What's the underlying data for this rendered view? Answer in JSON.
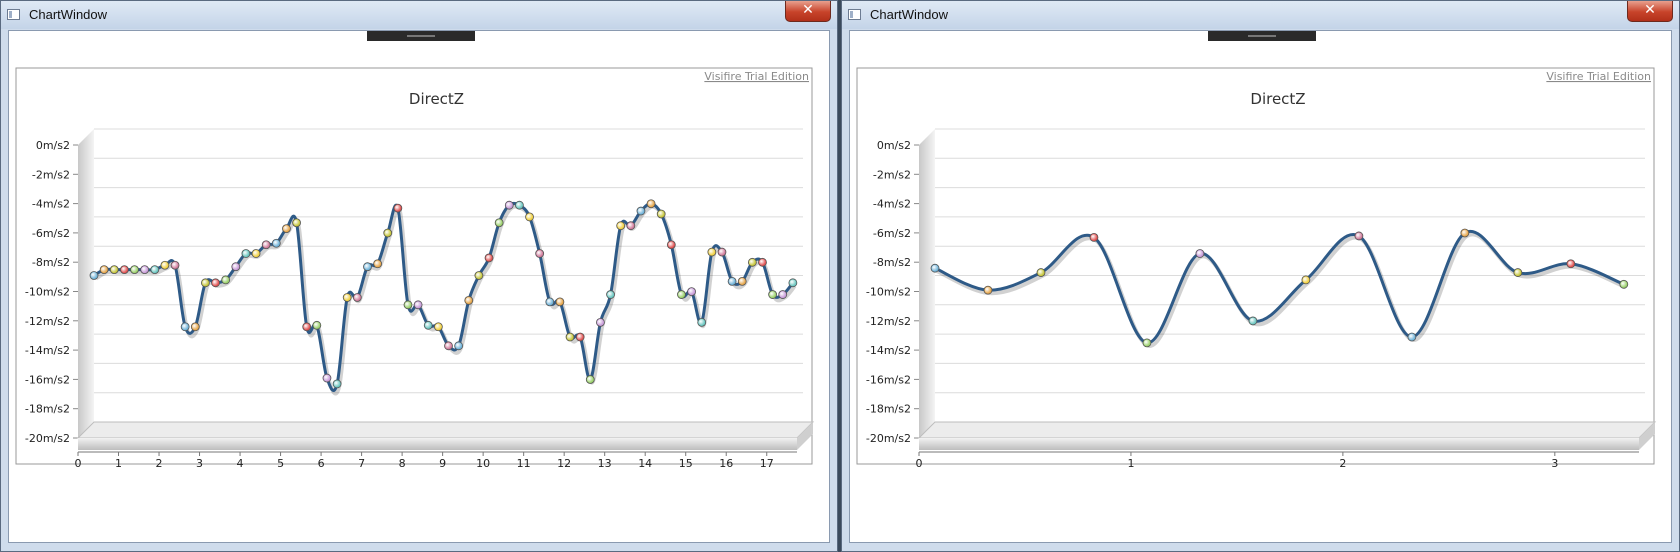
{
  "windows": [
    {
      "title": "ChartWindow",
      "close_label": "✕",
      "watermark": "Visifire Trial Edition",
      "chart_data": {
        "type": "line",
        "title": "DirectZ",
        "xlabel": "",
        "ylabel": "",
        "xlim": [
          0,
          17.5
        ],
        "ylim": [
          -20,
          0
        ],
        "xticks": [
          0,
          1,
          2,
          3,
          4,
          5,
          6,
          7,
          8,
          9,
          10,
          11,
          12,
          13,
          14,
          15,
          16,
          17
        ],
        "yticks": [
          0,
          -2,
          -4,
          -6,
          -8,
          -10,
          -12,
          -14,
          -16,
          -18,
          -20
        ],
        "ytick_labels": [
          "0m/s2",
          "-2m/s2",
          "-4m/s2",
          "-6m/s2",
          "-8m/s2",
          "-10m/s2",
          "-12m/s2",
          "-14m/s2",
          "-16m/s2",
          "-18m/s2",
          "-20m/s2"
        ],
        "grid": true,
        "series": [
          {
            "x": [
              0,
              0.25,
              0.5,
              0.75,
              1,
              1.25,
              1.5,
              1.75,
              2,
              2.25,
              2.5,
              2.75,
              3,
              3.25,
              3.5,
              3.75,
              4,
              4.25,
              4.5,
              4.75,
              5,
              5.25,
              5.5,
              5.75,
              6,
              6.25,
              6.5,
              6.75,
              7,
              7.25,
              7.5,
              7.75,
              8,
              8.25,
              8.5,
              8.75,
              9,
              9.25,
              9.5,
              9.75,
              10,
              10.25,
              10.5,
              10.75,
              11,
              11.25,
              11.5,
              11.75,
              12,
              12.25,
              12.5,
              12.75,
              13,
              13.25,
              13.5,
              13.75,
              14,
              14.25,
              14.5,
              14.75,
              15,
              15.25,
              15.5,
              15.75,
              16,
              16.25,
              16.5,
              16.75,
              17,
              17.25
            ],
            "y": [
              -10,
              -9.6,
              -9.6,
              -9.6,
              -9.6,
              -9.6,
              -9.6,
              -9.3,
              -9.3,
              -13.5,
              -13.5,
              -10.5,
              -10.5,
              -10.3,
              -9.4,
              -8.5,
              -8.5,
              -7.9,
              -7.8,
              -6.8,
              -6.4,
              -13.5,
              -13.4,
              -17,
              -17.4,
              -11.5,
              -11.5,
              -9.4,
              -9.2,
              -7.1,
              -5.4,
              -12,
              -12,
              -13.4,
              -13.5,
              -14.8,
              -14.8,
              -11.7,
              -10,
              -8.8,
              -6.4,
              -5.2,
              -5.2,
              -6,
              -8.5,
              -11.8,
              -11.8,
              -14.2,
              -14.2,
              -17.1,
              -13.2,
              -11.3,
              -6.6,
              -6.6,
              -5.6,
              -5.1,
              -5.8,
              -7.9,
              -11.3,
              -11.1,
              -13.2,
              -8.4,
              -8.4,
              -10.4,
              -10.4,
              -9.1,
              -9.1,
              -11.3,
              -11.3,
              -10.5
            ]
          }
        ]
      }
    },
    {
      "title": "ChartWindow",
      "close_label": "✕",
      "watermark": "Visifire Trial Edition",
      "chart_data": {
        "type": "line",
        "title": "DirectZ",
        "xlabel": "",
        "ylabel": "",
        "xlim": [
          0,
          3.35
        ],
        "ylim": [
          -20,
          0
        ],
        "xticks": [
          0,
          1,
          2,
          3
        ],
        "yticks": [
          0,
          -2,
          -4,
          -6,
          -8,
          -10,
          -12,
          -14,
          -16,
          -18,
          -20
        ],
        "ytick_labels": [
          "0m/s2",
          "-2m/s2",
          "-4m/s2",
          "-6m/s2",
          "-8m/s2",
          "-10m/s2",
          "-12m/s2",
          "-14m/s2",
          "-16m/s2",
          "-18m/s2",
          "-20m/s2"
        ],
        "grid": true,
        "series": [
          {
            "x": [
              0,
              0.25,
              0.5,
              0.75,
              1,
              1.25,
              1.5,
              1.75,
              2,
              2.25,
              2.5,
              2.75,
              3,
              3.25
            ],
            "y": [
              -9.5,
              -11,
              -9.8,
              -7.4,
              -14.6,
              -8.5,
              -13.1,
              -10.3,
              -7.3,
              -14.2,
              -7.1,
              -9.8,
              -9.2,
              -10.6
            ]
          }
        ]
      }
    }
  ]
}
